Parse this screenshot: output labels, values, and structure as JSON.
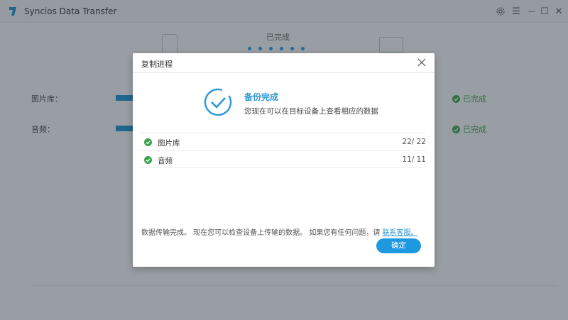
{
  "app": {
    "title": "Syncios Data Transfer"
  },
  "window_controls": {
    "settings_icon": "gear-icon",
    "menu_glyph": "☰",
    "minimize_glyph": "—",
    "maximize_glyph": "☐",
    "close_glyph": "✕"
  },
  "background": {
    "step_status": "已完成",
    "rows": [
      {
        "label": "图片库：",
        "status": "已完成"
      },
      {
        "label": "音频：",
        "status": "已完成"
      }
    ]
  },
  "dialog": {
    "title": "复制进程",
    "success_title": "备份完成",
    "success_subtitle": "您现在可以在目标设备上查看相应的数据",
    "items": [
      {
        "label": "图片库",
        "count": "22/ 22"
      },
      {
        "label": "音频",
        "count": "11/ 11"
      }
    ],
    "footer_text": "数据传输完成。 现在您可以检查设备上传输的数据。 如果您有任何问题，请",
    "footer_link": "联系客服。",
    "ok_label": "确定"
  },
  "colors": {
    "accent": "#1e98e0",
    "success": "#3aa349"
  }
}
